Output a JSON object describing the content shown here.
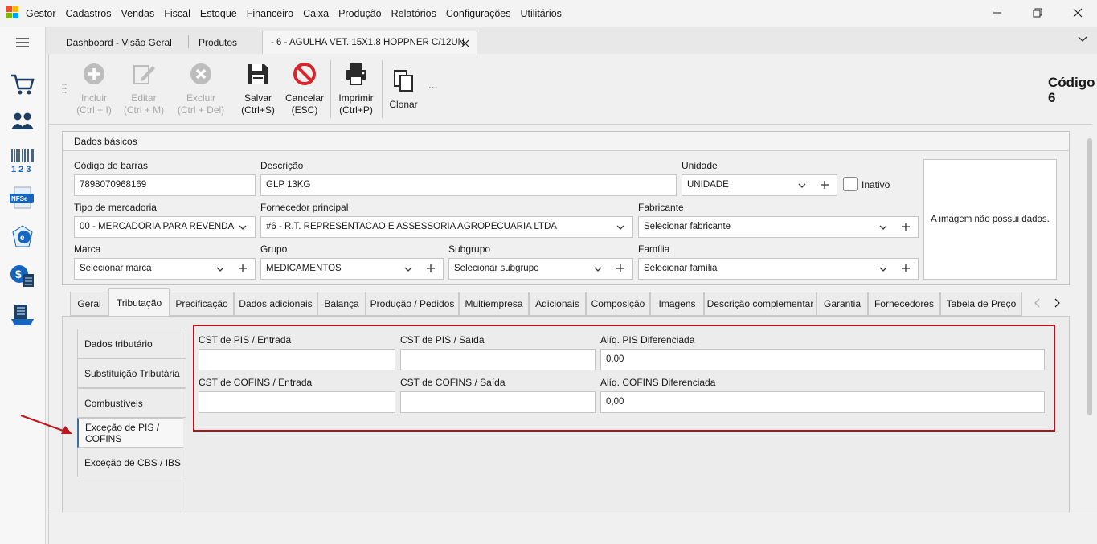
{
  "menubar": {
    "app_name": "Gestor",
    "items": [
      "Cadastros",
      "Vendas",
      "Fiscal",
      "Estoque",
      "Financeiro",
      "Caixa",
      "Produção",
      "Relatórios",
      "Configurações",
      "Utilitários"
    ]
  },
  "doc_tabs": [
    {
      "label": "Dashboard - Visão Geral"
    },
    {
      "label": "Produtos"
    },
    {
      "label": "- 6 - AGULHA VET. 15X1.8 HOPPNER C/12UN"
    }
  ],
  "toolbar": {
    "incluir": {
      "label": "Incluir",
      "shortcut": "(Ctrl + I)"
    },
    "editar": {
      "label": "Editar",
      "shortcut": "(Ctrl + M)"
    },
    "excluir": {
      "label": "Excluir",
      "shortcut": "(Ctrl + Del)"
    },
    "salvar": {
      "label": "Salvar",
      "shortcut": "(Ctrl+S)"
    },
    "cancelar": {
      "label": "Cancelar",
      "shortcut": "(ESC)"
    },
    "imprimir": {
      "label": "Imprimir",
      "shortcut": "(Ctrl+P)"
    },
    "clonar": {
      "label": "Clonar"
    },
    "more": "...",
    "codigo_label": "Código",
    "codigo_value": "6"
  },
  "dados_basicos": {
    "title": "Dados básicos",
    "codigo_barras": {
      "label": "Código de barras",
      "value": "7898070968169"
    },
    "descricao": {
      "label": "Descrição",
      "value": "GLP 13KG"
    },
    "unidade": {
      "label": "Unidade",
      "value": "UNIDADE"
    },
    "inativo": {
      "label": "Inativo",
      "checked": false
    },
    "tipo_mercadoria": {
      "label": "Tipo de mercadoria",
      "value": "00 - MERCADORIA PARA REVENDA"
    },
    "fornecedor": {
      "label": "Fornecedor principal",
      "value": "#6 - R.T. REPRESENTACAO E ASSESSORIA AGROPECUARIA LTDA"
    },
    "fabricante": {
      "label": "Fabricante",
      "value": "Selecionar fabricante"
    },
    "marca": {
      "label": "Marca",
      "value": "Selecionar marca"
    },
    "grupo": {
      "label": "Grupo",
      "value": "MEDICAMENTOS"
    },
    "subgrupo": {
      "label": "Subgrupo",
      "value": "Selecionar subgrupo"
    },
    "familia": {
      "label": "Família",
      "value": "Selecionar família"
    },
    "imagem_text": "A imagem não possui dados."
  },
  "tabs": [
    "Geral",
    "Tributação",
    "Precificação",
    "Dados adicionais",
    "Balança",
    "Produção / Pedidos",
    "Multiempresa",
    "Adicionais",
    "Composição",
    "Imagens",
    "Descrição complementar",
    "Garantia",
    "Fornecedores",
    "Tabela de Preço"
  ],
  "vtabs": [
    "Dados tributário",
    "Substituição Tributária",
    "Combustíveis",
    "Exceção de PIS / COFINS",
    "Exceção de CBS / IBS"
  ],
  "pis_cofins": {
    "cst_pis_entrada": {
      "label": "CST de PIS / Entrada",
      "value": ""
    },
    "cst_pis_saida": {
      "label": "CST de PIS / Saída",
      "value": ""
    },
    "aliq_pis": {
      "label": "Alíq. PIS Diferenciada",
      "value": "0,00"
    },
    "cst_cofins_entrada": {
      "label": "CST de COFINS / Entrada",
      "value": ""
    },
    "cst_cofins_saida": {
      "label": "CST de COFINS / Saída",
      "value": ""
    },
    "aliq_cofins": {
      "label": "Alíq. COFINS Diferenciada",
      "value": "0,00"
    }
  },
  "colors": {
    "highlight_border": "#b3121b",
    "arrow": "#c0171f"
  }
}
